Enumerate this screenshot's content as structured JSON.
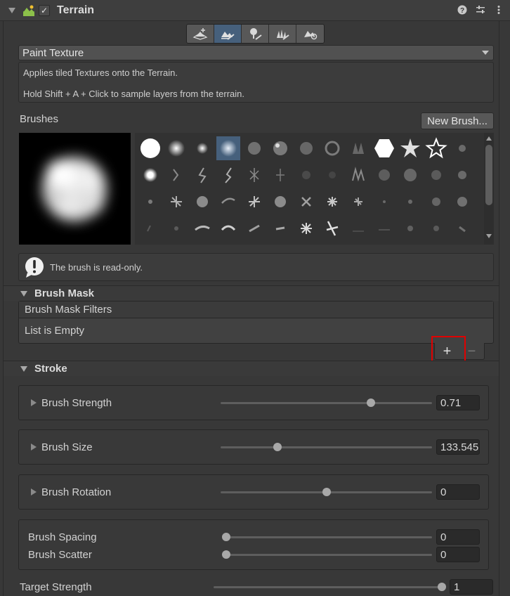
{
  "header": {
    "title": "Terrain"
  },
  "toolbar": {
    "tools": [
      {
        "icon": "raise-terrain-icon",
        "active": false
      },
      {
        "icon": "paint-terrain-icon",
        "active": true
      },
      {
        "icon": "paint-trees-icon",
        "active": false
      },
      {
        "icon": "paint-details-icon",
        "active": false
      },
      {
        "icon": "terrain-settings-icon",
        "active": false
      }
    ]
  },
  "tool_dropdown": {
    "value": "Paint Texture"
  },
  "description": {
    "line1": "Applies tiled Textures onto the Terrain.",
    "line2": "Hold Shift + A + Click to sample layers from the terrain."
  },
  "brushes": {
    "label": "Brushes",
    "new_brush_label": "New Brush..."
  },
  "help_box": {
    "text": "The brush is read-only."
  },
  "brush_mask": {
    "title": "Brush Mask",
    "list_header": "Brush Mask Filters",
    "list_empty": "List is Empty",
    "add_label": "+",
    "remove_label": "−"
  },
  "stroke": {
    "title": "Stroke",
    "brush_strength": {
      "label": "Brush Strength",
      "value": "0.71",
      "fraction": 0.71
    },
    "brush_size": {
      "label": "Brush Size",
      "value": "133.545",
      "fraction": 0.27
    },
    "brush_rotation": {
      "label": "Brush Rotation",
      "value": "0",
      "fraction": 0.5
    },
    "brush_spacing": {
      "label": "Brush Spacing",
      "value": "0",
      "fraction": 0
    },
    "brush_scatter": {
      "label": "Brush Scatter",
      "value": "0",
      "fraction": 0
    },
    "target_strength": {
      "label": "Target Strength",
      "value": "1",
      "fraction": 1
    }
  },
  "colors": {
    "accent": "#46607c",
    "highlight": "#e00000"
  }
}
